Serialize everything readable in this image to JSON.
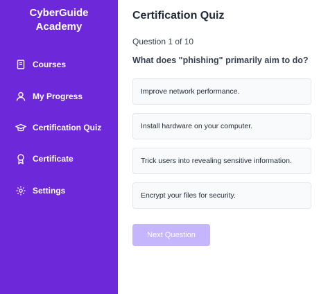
{
  "sidebar": {
    "brand_line1": "CyberGuide",
    "brand_line2": "Academy",
    "items": [
      {
        "label": "Courses",
        "icon": "book-icon"
      },
      {
        "label": "My Progress",
        "icon": "user-icon"
      },
      {
        "label": "Certification Quiz",
        "icon": "graduation-cap-icon"
      },
      {
        "label": "Certificate",
        "icon": "award-icon"
      },
      {
        "label": "Settings",
        "icon": "gear-icon"
      }
    ]
  },
  "main": {
    "title": "Certification Quiz",
    "question_number": "Question 1 of 10",
    "question": "What does \"phishing\" primarily aim to do?",
    "options": [
      "Improve network performance.",
      "Install hardware on your computer.",
      "Trick users into revealing sensitive information.",
      "Encrypt your files for security."
    ],
    "next_button": "Next Question"
  },
  "colors": {
    "sidebar_bg": "#6d28d9",
    "button_disabled": "#c4b5fd",
    "option_bg": "#f9fafb"
  }
}
